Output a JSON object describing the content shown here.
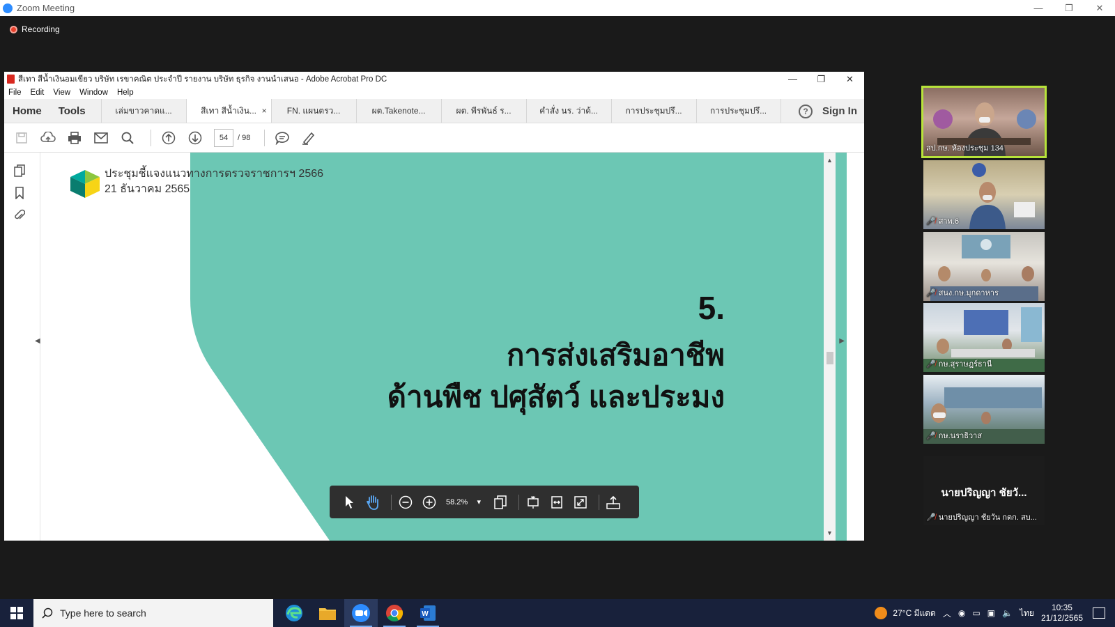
{
  "zoom": {
    "window_title": "Zoom Meeting",
    "recording_label": "Recording",
    "controls": {
      "minimize": "—",
      "restore": "❐",
      "close": "✕"
    }
  },
  "acrobat": {
    "window_title": "สีเทา สีน้ำเงินอมเขียว บริษัท เรขาคณิต ประจำปี รายงาน บริษัท ธุรกิจ งานนำเสนอ - Adobe Acrobat Pro DC",
    "menu": [
      "File",
      "Edit",
      "Window",
      "Help"
    ],
    "home_tab": "Home",
    "tools_tab": "Tools",
    "tabs": [
      {
        "label": "เล่มขาวคาดแ...",
        "active": false
      },
      {
        "label": "สีเทา สีน้ำเงิน...",
        "active": true
      },
      {
        "label": "FN. แผนตรว...",
        "active": false
      },
      {
        "label": "ผต.Takenote...",
        "active": false
      },
      {
        "label": "ผต. พีรพันธ์ ร...",
        "active": false
      },
      {
        "label": "คำสั่ง นร. ว่าด้...",
        "active": false
      },
      {
        "label": "การประชุมปรึ...",
        "active": false
      },
      {
        "label": "การประชุมปรึ...",
        "active": false
      }
    ],
    "tab_close": "×",
    "help": "?",
    "sign_in": "Sign In",
    "current_page": "54",
    "total_pages": "/ 98",
    "zoom_level": "58.2%",
    "colors": {
      "slide_teal": "#6cc7b4",
      "toolbar_dark": "#2f2f2f"
    }
  },
  "slide": {
    "header_line1": "ประชุมชี้แจงแนวทางการตรวจราชการฯ 2566",
    "header_line2": "21 ธันวาคม 2565",
    "title_number": "5.",
    "title_line1": "การส่งเสริมอาชีพ",
    "title_line2": "ด้านพืช ปศุสัตว์ และประมง"
  },
  "participants": [
    {
      "name": "สป.กษ. ห้องประชุม 134",
      "muted": false,
      "active": true
    },
    {
      "name": "สาพ.6",
      "muted": true
    },
    {
      "name": "สนง.กษ.มุกดาหาร",
      "muted": true
    },
    {
      "name": "กษ.สุราษฎร์ธานี",
      "muted": true
    },
    {
      "name": "กษ.นราธิวาส",
      "muted": true
    }
  ],
  "name_only_participant": {
    "display": "นายปริญญา ชัยวั...",
    "full_name": "นายปริญญา ชัยวัน กตก. สบ..."
  },
  "taskbar": {
    "search_placeholder": "Type here to search",
    "weather": "27°C มีแดด",
    "language": "ไทย",
    "time": "10:35",
    "date": "21/12/2565"
  }
}
